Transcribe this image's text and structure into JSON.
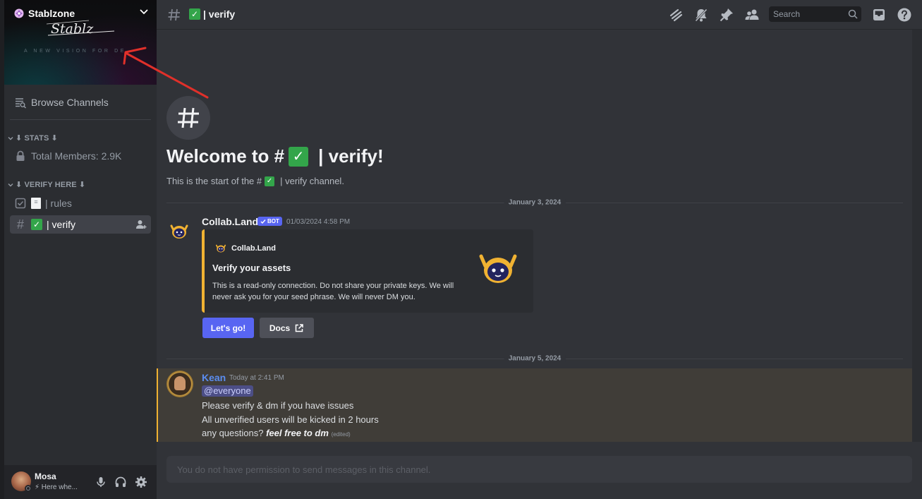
{
  "server": {
    "name": "Stablzone",
    "banner_logo": "Stablz",
    "banner_tagline": "A NEW VISION FOR DE"
  },
  "sidebar": {
    "browse_label": "Browse Channels",
    "categories": [
      {
        "label": "⬇ STATS ⬇",
        "channels": [
          {
            "label": "Total Members: 2.9K",
            "icon": "lock-icon"
          }
        ]
      },
      {
        "label": "⬇ VERIFY HERE ⬇",
        "channels": [
          {
            "label": "| rules",
            "icon": "rules-channel-icon",
            "emoji": "memo"
          },
          {
            "label": "| verify",
            "icon": "hash-icon",
            "emoji": "check",
            "active": true
          }
        ]
      }
    ]
  },
  "user": {
    "name": "Mosa",
    "status": "⚡ Here whe..."
  },
  "channel": {
    "name": "| verify",
    "search_placeholder": "Search",
    "welcome_prefix": "Welcome to #",
    "welcome_suffix": "| verify!",
    "welcome_sub_prefix": "This is the start of the #",
    "welcome_sub_suffix": "| verify channel.",
    "composer_placeholder": "You do not have permission to send messages in this channel."
  },
  "messages": {
    "date1": "January 3, 2024",
    "bot": {
      "author": "Collab.Land",
      "tag": "BOT",
      "time": "01/03/2024 4:58 PM",
      "embed_author": "Collab.Land",
      "embed_title": "Verify your assets",
      "embed_desc": "This is a read-only connection. Do not share your private keys. We will never ask you for your seed phrase. We will never DM you.",
      "btn_primary": "Let's go!",
      "btn_secondary": "Docs"
    },
    "date2": "January 5, 2024",
    "kean": {
      "author": "Kean",
      "time": "Today at 2:41 PM",
      "mention": "@everyone",
      "line1": "Please verify & dm if you have issues",
      "line2": "All unverified users will be kicked in 2 hours",
      "line3_prefix": "any questions?",
      "line3_bold": "feel free to dm",
      "edited": "(edited)"
    }
  },
  "colors": {
    "accent": "#5865f2",
    "highlight_border": "#f0b232",
    "check_green": "#33a54a",
    "author_blue": "#5b8df0"
  }
}
